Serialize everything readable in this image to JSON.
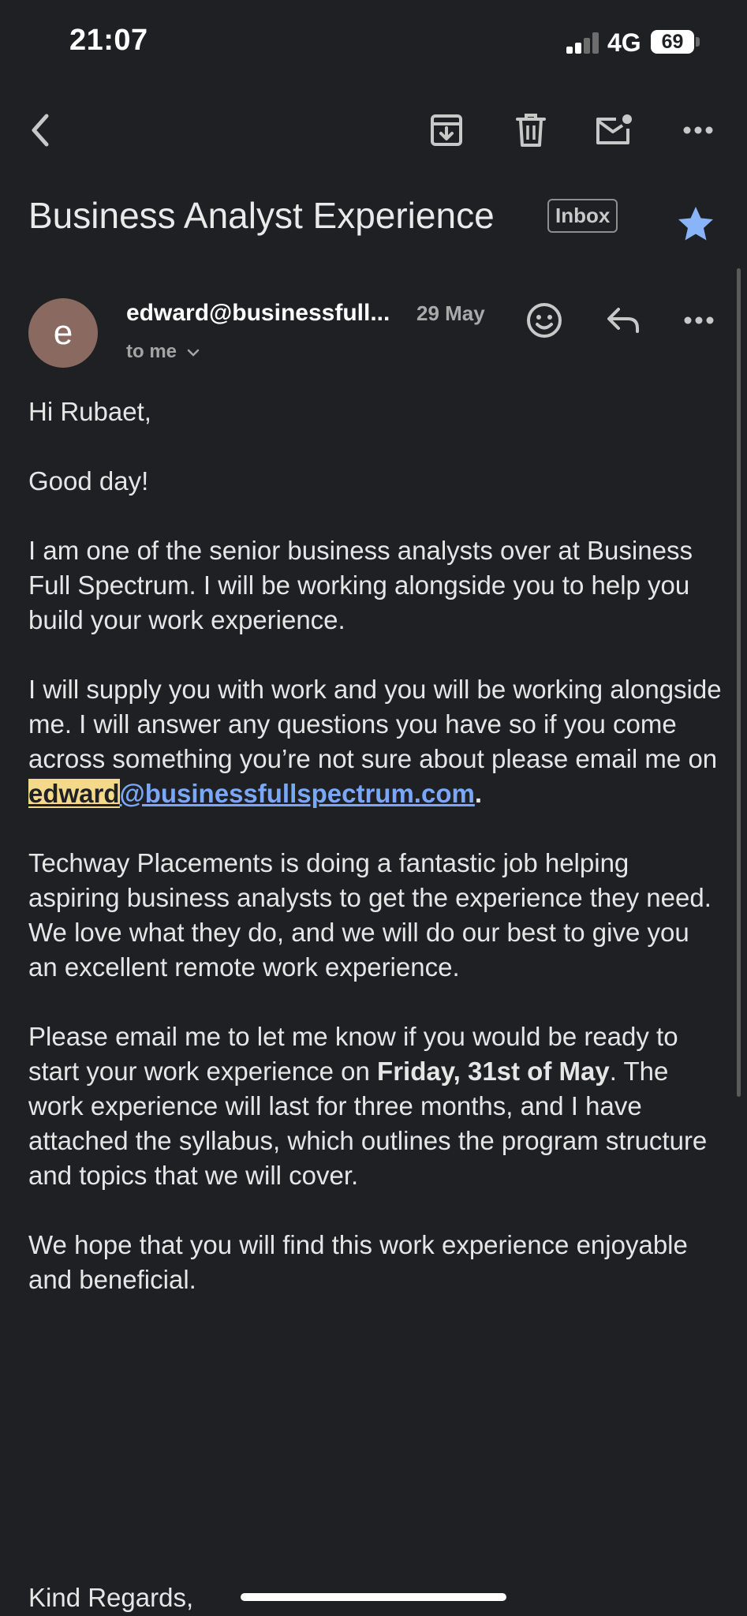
{
  "status_bar": {
    "time": "21:07",
    "network": "4G",
    "battery": "69"
  },
  "toolbar": {
    "icons": [
      "back-icon",
      "archive-icon",
      "delete-icon",
      "mark-unread-icon",
      "more-icon"
    ]
  },
  "email": {
    "subject": "Business Analyst Experience",
    "label": "Inbox",
    "starred": true,
    "star_color": "#8ab4f8",
    "sender": {
      "avatar_letter": "e",
      "avatar_color": "#8a6a60",
      "name": "edward@businessfull...",
      "date": "29 May",
      "to": "to me"
    },
    "body": {
      "greeting": "Hi Rubaet,",
      "p1": "Good day!",
      "p2": "I am one of the senior business analysts over at Business Full Spectrum.  I will be working alongside you to help you build your work experience.",
      "p3_text": "I will supply you with work and you will be working alongside me. I will answer any questions you have so if you come across something you’re not sure about please email me on",
      "p3_email_highlight": "edward",
      "p3_email_rest": "@businessfullspectrum.com",
      "p3_end": ".",
      "p4": "Techway Placements is doing a fantastic job helping aspiring business analysts to get the experience they need. We love what they do, and we will do our best to give you an excellent remote work experience.",
      "p5_start": "Please email me to let me know if you would be ready to start your work experience on ",
      "p5_bold": "Friday, 31st of May",
      "p5_end": ". The work experience will last for three months, and I have attached the syllabus, which outlines the program structure and topics that we will cover.",
      "p6": "We hope that you will find this work experience enjoyable and beneficial.",
      "signoff": "Kind Regards,"
    }
  }
}
